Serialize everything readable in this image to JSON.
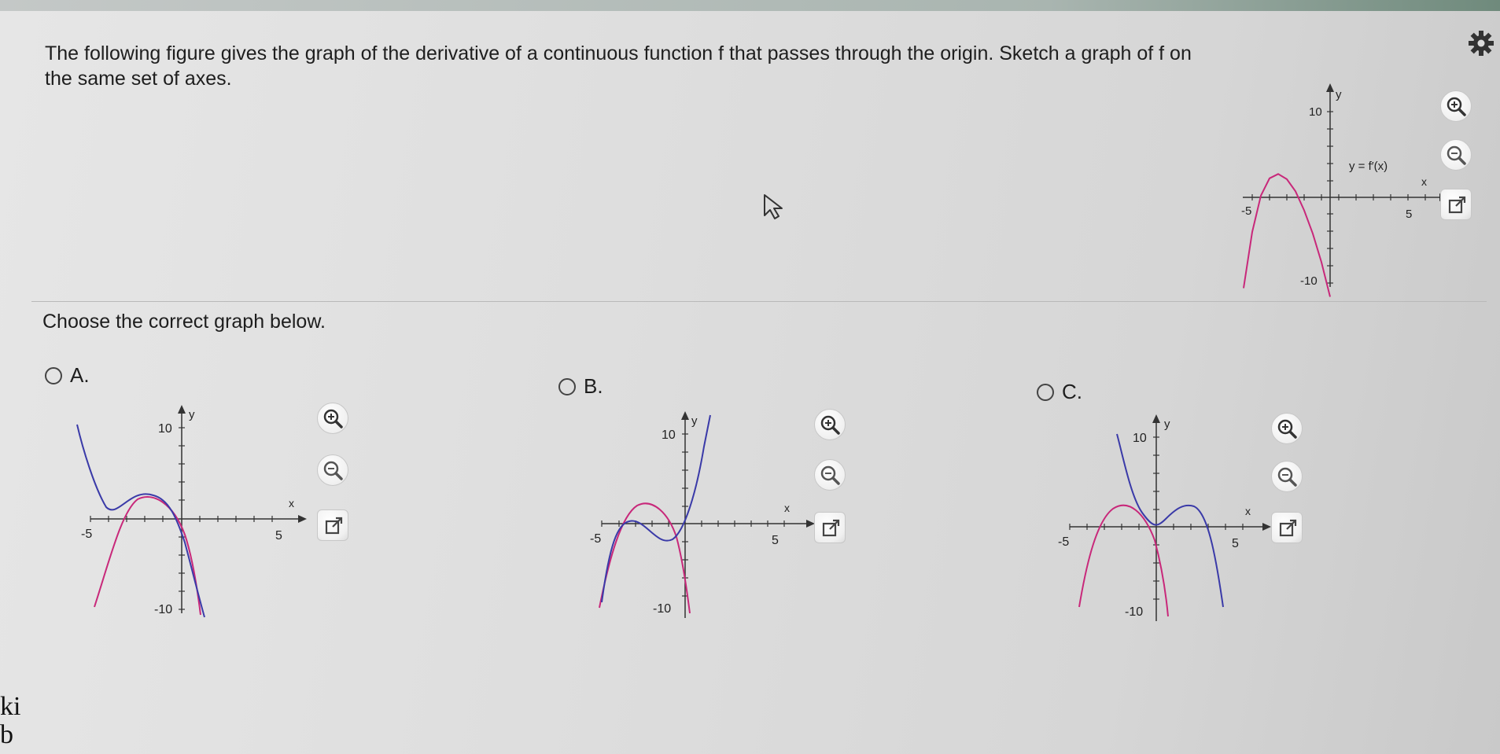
{
  "question": {
    "text": "The following figure gives the graph of the derivative of a continuous function f that passes through the origin. Sketch a graph of f on the same set of axes."
  },
  "prompt": {
    "label": "Choose the correct graph below."
  },
  "main_graph": {
    "curve_label": "y = f′(x)",
    "x_axis_label": "x",
    "y_axis_label": "y",
    "tick_labels": {
      "x_min": "-5",
      "x_max": "5",
      "y_max": "10",
      "y_min": "-10"
    },
    "chart_data": {
      "type": "line",
      "xlim": [
        -6,
        6
      ],
      "ylim": [
        -11,
        12
      ],
      "series": [
        {
          "color": "#c8287a",
          "x": [
            -5,
            -4.5,
            -4,
            -3.5,
            -3,
            -2.5,
            -2,
            -1.5,
            -1,
            -0.5,
            0
          ],
          "y": [
            -10.5,
            -4,
            0.2,
            2.2,
            2.7,
            2.1,
            0.7,
            -1.5,
            -4.2,
            -7.5,
            -11.5
          ]
        }
      ]
    }
  },
  "options": [
    {
      "label": "A.",
      "letter": "A",
      "x_axis_label": "x",
      "y_axis_label": "y",
      "tick_labels": {
        "x_min": "-5",
        "x_max": "5",
        "y_max": "10",
        "y_min": "-10"
      }
    },
    {
      "label": "B.",
      "letter": "B",
      "x_axis_label": "x",
      "y_axis_label": "y",
      "tick_labels": {
        "x_min": "-5",
        "x_max": "5",
        "y_max": "10",
        "y_min": "-10"
      }
    },
    {
      "label": "C.",
      "letter": "C",
      "x_axis_label": "x",
      "y_axis_label": "y",
      "tick_labels": {
        "x_min": "-5",
        "x_max": "5",
        "y_max": "10",
        "y_min": "-10"
      }
    }
  ],
  "colors": {
    "derivative": "#c8287a",
    "function": "#3a3aa8",
    "axis": "#333333"
  },
  "icons": [
    "gear-icon",
    "zoom-in-icon",
    "zoom-out-icon",
    "popout-icon"
  ],
  "left_edge_text": [
    "ki",
    "b"
  ]
}
